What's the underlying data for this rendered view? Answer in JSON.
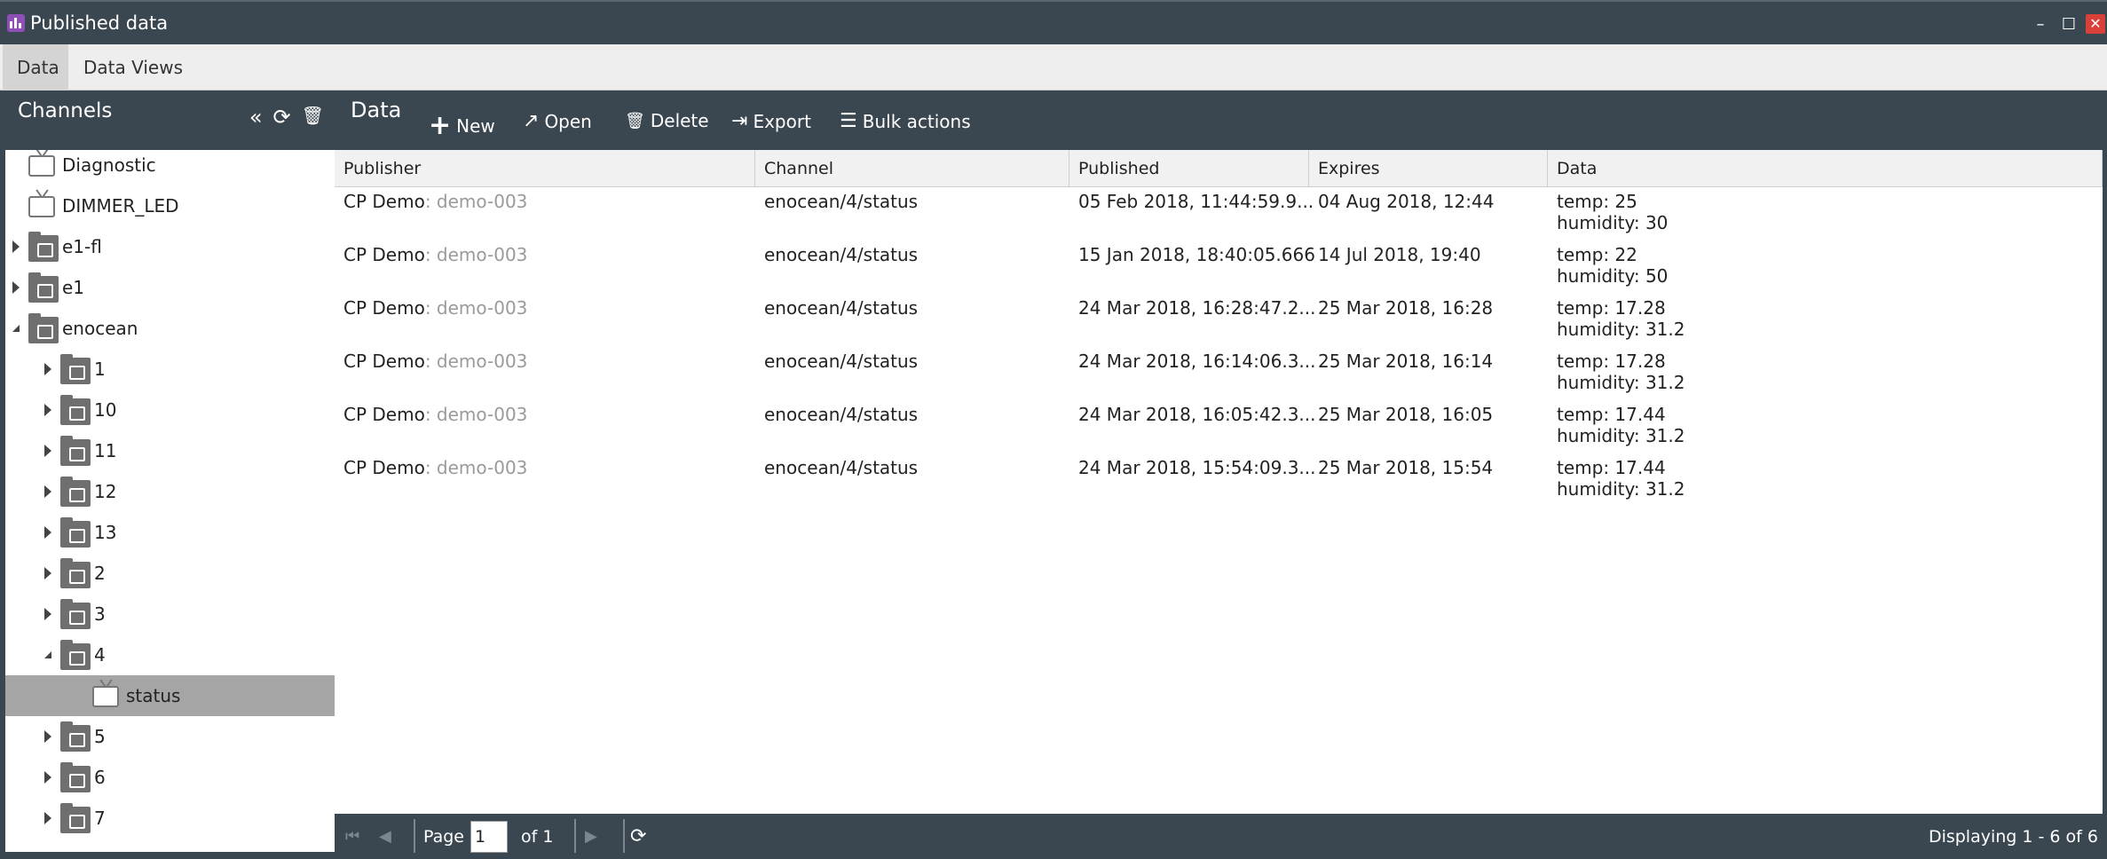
{
  "window": {
    "title": "Published data",
    "controls": {
      "minimize": "–",
      "maximize": "☐",
      "close": "✕"
    }
  },
  "tabs": [
    {
      "label": "Data",
      "active": true
    },
    {
      "label": "Data Views",
      "active": false
    }
  ],
  "sidebar": {
    "title": "Channels",
    "tools": {
      "collapse": "«",
      "refresh": "⟳",
      "delete": "🗑"
    },
    "tree": [
      {
        "label": "Diagnostic",
        "icon": "channel-icon",
        "expander": "none",
        "level": 0
      },
      {
        "label": "DIMMER_LED",
        "icon": "channel-icon",
        "expander": "none",
        "level": 0
      },
      {
        "label": "e1-fl",
        "icon": "folder-icon",
        "expander": "collapsed",
        "level": 0
      },
      {
        "label": "e1",
        "icon": "folder-icon",
        "expander": "collapsed",
        "level": 0
      },
      {
        "label": "enocean",
        "icon": "folder-open-icon",
        "expander": "expanded",
        "level": 0
      },
      {
        "label": "1",
        "icon": "folder-icon",
        "expander": "collapsed",
        "level": 1
      },
      {
        "label": "10",
        "icon": "folder-icon",
        "expander": "collapsed",
        "level": 1
      },
      {
        "label": "11",
        "icon": "folder-icon",
        "expander": "collapsed",
        "level": 1
      },
      {
        "label": "12",
        "icon": "folder-icon",
        "expander": "collapsed",
        "level": 1
      },
      {
        "label": "13",
        "icon": "folder-icon",
        "expander": "collapsed",
        "level": 1
      },
      {
        "label": "2",
        "icon": "folder-icon",
        "expander": "collapsed",
        "level": 1
      },
      {
        "label": "3",
        "icon": "folder-icon",
        "expander": "collapsed",
        "level": 1
      },
      {
        "label": "4",
        "icon": "folder-open-icon",
        "expander": "expanded",
        "level": 1
      },
      {
        "label": "status",
        "icon": "channel-icon",
        "expander": "none",
        "level": 2,
        "selected": true
      },
      {
        "label": "5",
        "icon": "folder-icon",
        "expander": "collapsed",
        "level": 1
      },
      {
        "label": "6",
        "icon": "folder-icon",
        "expander": "collapsed",
        "level": 1
      },
      {
        "label": "7",
        "icon": "folder-icon",
        "expander": "collapsed",
        "level": 1
      }
    ]
  },
  "main": {
    "title": "Data",
    "toolbar": [
      {
        "label": "New",
        "icon": "plus-icon",
        "glyph": "+"
      },
      {
        "label": "Open",
        "icon": "open-icon",
        "glyph": "↗"
      },
      {
        "label": "Delete",
        "icon": "trash-icon",
        "glyph": "🗑"
      },
      {
        "label": "Export",
        "icon": "export-icon",
        "glyph": "⇥"
      },
      {
        "label": "Bulk actions",
        "icon": "list-icon",
        "glyph": "☰"
      }
    ],
    "columns": [
      "Publisher",
      "Channel",
      "Published",
      "Expires",
      "Data"
    ],
    "rows": [
      {
        "publisher": "CP Demo",
        "publisher_id": ": demo-003",
        "channel": "enocean/4/status",
        "published": "05 Feb 2018, 11:44:59.9...",
        "expires": "04 Aug 2018, 12:44",
        "data1": "temp: 25",
        "data2": "humidity: 30"
      },
      {
        "publisher": "CP Demo",
        "publisher_id": ": demo-003",
        "channel": "enocean/4/status",
        "published": "15 Jan 2018, 18:40:05.666",
        "expires": "14 Jul 2018, 19:40",
        "data1": "temp: 22",
        "data2": "humidity: 50"
      },
      {
        "publisher": "CP Demo",
        "publisher_id": ": demo-003",
        "channel": "enocean/4/status",
        "published": "24 Mar 2018, 16:28:47.2...",
        "expires": "25 Mar 2018, 16:28",
        "data1": "temp: 17.28",
        "data2": "humidity: 31.2"
      },
      {
        "publisher": "CP Demo",
        "publisher_id": ": demo-003",
        "channel": "enocean/4/status",
        "published": "24 Mar 2018, 16:14:06.3...",
        "expires": "25 Mar 2018, 16:14",
        "data1": "temp: 17.28",
        "data2": "humidity: 31.2"
      },
      {
        "publisher": "CP Demo",
        "publisher_id": ": demo-003",
        "channel": "enocean/4/status",
        "published": "24 Mar 2018, 16:05:42.3...",
        "expires": "25 Mar 2018, 16:05",
        "data1": "temp: 17.44",
        "data2": "humidity: 31.2"
      },
      {
        "publisher": "CP Demo",
        "publisher_id": ": demo-003",
        "channel": "enocean/4/status",
        "published": "24 Mar 2018, 15:54:09.3...",
        "expires": "25 Mar 2018, 15:54",
        "data1": "temp: 17.44",
        "data2": "humidity: 31.2"
      }
    ]
  },
  "pager": {
    "first": "⏮",
    "prev": "◀",
    "next": "▶",
    "last": "⏭",
    "refresh": "⟳",
    "page_label": "Page",
    "page_value": "1",
    "of_label": "of 1",
    "status": "Displaying 1 - 6 of 6"
  },
  "colors": {
    "chrome": "#3a4750",
    "accent": "#8e4fb8",
    "selected": "#a5a5a5",
    "close": "#d9403a"
  }
}
